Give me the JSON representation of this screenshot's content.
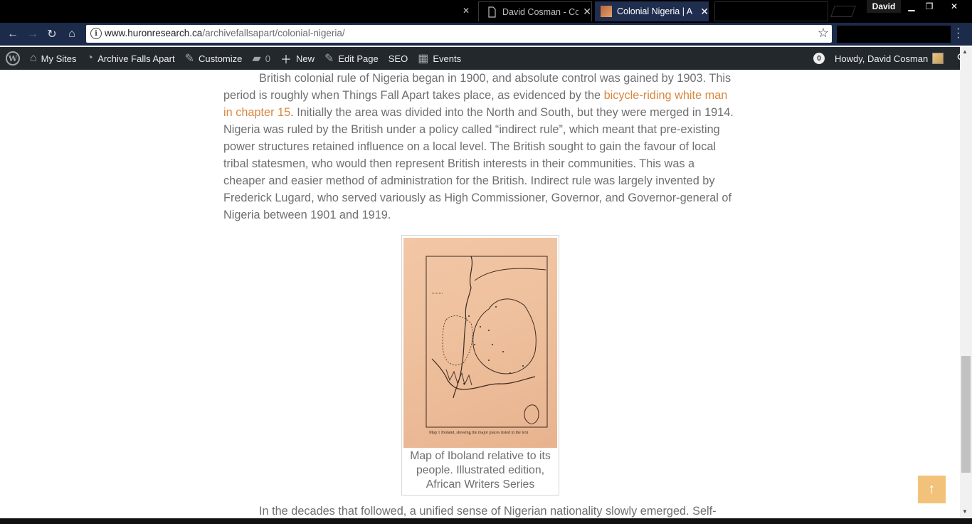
{
  "browser": {
    "tabs": [
      {
        "title": "",
        "active": false
      },
      {
        "title": "David Cosman - Co",
        "active": false
      },
      {
        "title": "Colonial Nigeria | A",
        "active": true
      },
      {
        "title": "",
        "active": false
      }
    ],
    "profile_name": "David",
    "url_domain": "www.huronresearch.ca",
    "url_path": "/archivefallsapart/colonial-nigeria/"
  },
  "adminbar": {
    "my_sites": "My Sites",
    "site_name": "Archive Falls Apart",
    "customize": "Customize",
    "comments_count": "0",
    "new": "New",
    "edit_page": "Edit Page",
    "seo": "SEO",
    "events": "Events",
    "notifications_count": "0",
    "howdy": "Howdy, David Cosman"
  },
  "article": {
    "para1_before_link": "British colonial rule of Nigeria began in 1900, and absolute control was gained by 1903. This period is roughly when Things Fall Apart takes place, as evidenced by the ",
    "para1_link": "bicycle-riding white man in chapter 15",
    "para1_after_link": ". Initially the area was divided into the North and South, but they were merged in 1914. Nigeria was ruled by the British under a policy called “indirect rule”, which meant that pre-existing power structures retained influence on a local level. The British sought to gain the favour of local tribal statesmen, who would then represent British interests in their communities. This was a cheaper and easier method of administration for the British. Indirect rule was largely invented by Frederick Lugard, who served variously as High Commissioner, Governor, and Governor-general of Nigeria between 1901 and 1919.",
    "figure_caption": "Map of Iboland relative to its people. Illustrated edition, African Writers Series",
    "map_footer": "Map 1   Iboland, showing the major places listed in the text",
    "para2": "In the decades that followed, a unified sense of Nigerian nationality slowly emerged. Self-"
  },
  "colors": {
    "link": "#d9873f",
    "body_text": "#6f6f6f",
    "adminbar_bg": "#23282d",
    "back_to_top": "#f3c27a"
  }
}
